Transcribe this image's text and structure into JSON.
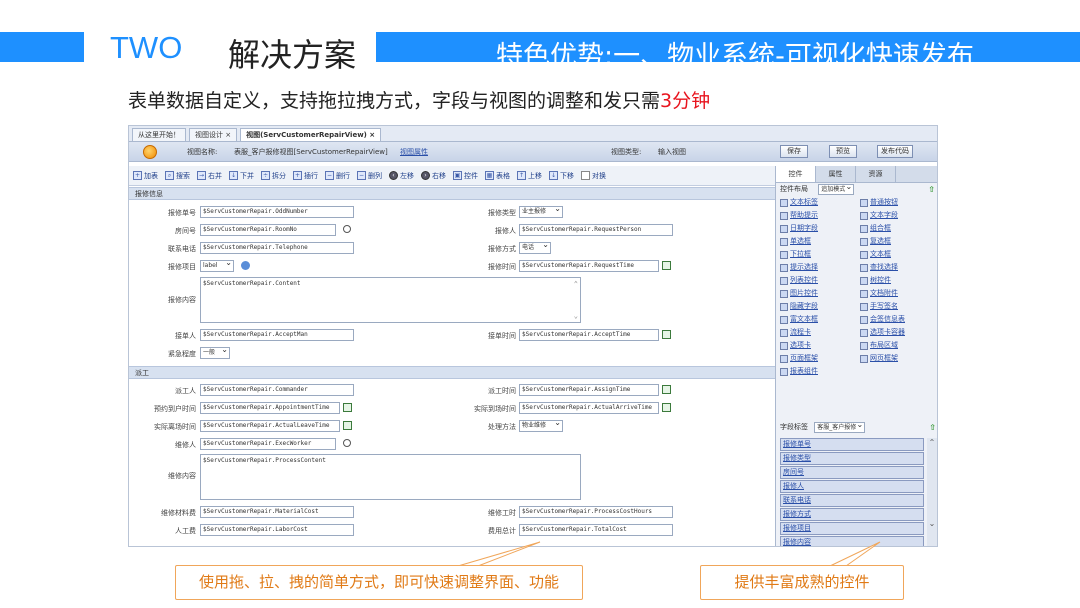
{
  "header": {
    "section_number": "TWO",
    "section_title": "解决方案",
    "feature_title": "特色优势:一、物业系统-可视化快速发布",
    "subtitle_main": "表单数据自定义，支持拖拉拽方式，字段与视图的调整和发只需",
    "subtitle_accent": "3分钟"
  },
  "colors": {
    "brand_blue": "#1e90ff",
    "accent_red": "#e8141e",
    "callout_orange": "#e07a16"
  },
  "screenshot": {
    "tabs": [
      "从这里开始！",
      "视图设计 ×",
      "视图(ServCustomerRepairView) ×"
    ],
    "view_name_label": "视图名称:",
    "view_name_value": "表服_客户报修视图[ServCustomerRepairView]",
    "view_property_link": "视图属性",
    "view_type_label": "视图类型:",
    "view_type_value": "输入视图",
    "buttons": {
      "save": "保存",
      "preview": "预览",
      "publish": "发布代码"
    },
    "toolbar": [
      "加表",
      "搜索",
      "右并",
      "下并",
      "拆分",
      "插行",
      "删行",
      "删列",
      "左移",
      "右移",
      "控件",
      "表格",
      "上移",
      "下移",
      "对换"
    ],
    "sections": {
      "repair_info": "报修信息",
      "dispatch": "派工"
    },
    "fields": {
      "odd_number": {
        "label": "报修单号",
        "value": "$ServCustomerRepair.OddNumber"
      },
      "repair_type": {
        "label": "报修类型",
        "value": "业主报修"
      },
      "room_no": {
        "label": "房间号",
        "value": "$ServCustomerRepair.RoomNo"
      },
      "request_person": {
        "label": "报修人",
        "value": "$ServCustomerRepair.RequestPerson"
      },
      "telephone": {
        "label": "联系电话",
        "value": "$ServCustomerRepair.Telephone"
      },
      "repair_method": {
        "label": "报修方式",
        "value": "电话"
      },
      "repair_item": {
        "label": "报修项目",
        "value": "label"
      },
      "request_time": {
        "label": "报修时间",
        "value": "$ServCustomerRepair.RequestTime"
      },
      "content": {
        "label": "报修内容",
        "value": "$ServCustomerRepair.Content"
      },
      "accept_man": {
        "label": "接单人",
        "value": "$ServCustomerRepair.AcceptMan"
      },
      "accept_time": {
        "label": "接单时间",
        "value": "$ServCustomerRepair.AcceptTime"
      },
      "urgency": {
        "label": "紧急程度",
        "value": "一般"
      },
      "commander": {
        "label": "派工人",
        "value": "$ServCustomerRepair.Commander"
      },
      "assign_time": {
        "label": "派工时间",
        "value": "$ServCustomerRepair.AssignTime"
      },
      "appointment_time": {
        "label": "预约到户时间",
        "value": "$ServCustomerRepair.AppointmentTime"
      },
      "actual_arrive_time": {
        "label": "实际到场时间",
        "value": "$ServCustomerRepair.ActualArriveTime"
      },
      "actual_leave_time": {
        "label": "实际离场时间",
        "value": "$ServCustomerRepair.ActualLeaveTime"
      },
      "process_method": {
        "label": "处理方法",
        "value": "物业维修"
      },
      "exec_worker": {
        "label": "维修人",
        "value": "$ServCustomerRepair.ExecWorker"
      },
      "process_content": {
        "label": "维修内容",
        "value": "$ServCustomerRepair.ProcessContent"
      },
      "material_cost": {
        "label": "维修材料费",
        "value": "$ServCustomerRepair.MaterialCost"
      },
      "process_cost_hours": {
        "label": "维修工时",
        "value": "$ServCustomerRepair.ProcessCostHours"
      },
      "labor_cost": {
        "label": "人工费",
        "value": "$ServCustomerRepair.LaborCost"
      },
      "total_cost": {
        "label": "费用总计",
        "value": "$ServCustomerRepair.TotalCost"
      }
    },
    "panel": {
      "tabs": [
        "控件",
        "属性",
        "资源"
      ],
      "layout_label": "控件布局",
      "layout_value": "追加模式",
      "controls": [
        "文本标签",
        "普通按钮",
        "帮助提示",
        "文本字段",
        "日期字段",
        "组合框",
        "单选框",
        "复选框",
        "下拉框",
        "文本框",
        "提示选择",
        "查找选择",
        "列表控件",
        "树控件",
        "图片控件",
        "文档附件",
        "隐藏字段",
        "手写签名",
        "富文本框",
        "会签信息表",
        "流程卡",
        "选项卡容器",
        "选项卡",
        "布局区域",
        "页面框架",
        "网页框架",
        "报表组件"
      ],
      "field_label_caption": "字段标签",
      "field_label_value": "客服_客户报修",
      "field_list": [
        "报修单号",
        "报修类型",
        "房间号",
        "报修人",
        "联系电话",
        "报修方式",
        "报修项目",
        "报修内容"
      ]
    }
  },
  "callouts": {
    "left": "使用拖、拉、拽的简单方式，即可快速调整界面、功能",
    "right": "提供丰富成熟的控件"
  }
}
